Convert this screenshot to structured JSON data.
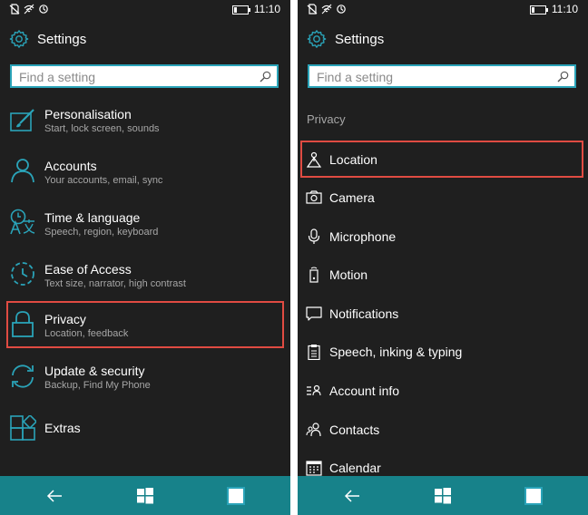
{
  "status": {
    "time": "11:10"
  },
  "left": {
    "header_title": "Settings",
    "search_placeholder": "Find a setting",
    "items": [
      {
        "label": "Personalisation",
        "sub": "Start, lock screen, sounds",
        "icon": "personalisation-icon"
      },
      {
        "label": "Accounts",
        "sub": "Your accounts, email, sync",
        "icon": "person-icon"
      },
      {
        "label": "Time & language",
        "sub": "Speech, region, keyboard",
        "icon": "time-language-icon"
      },
      {
        "label": "Ease of Access",
        "sub": "Text size, narrator, high contrast",
        "icon": "ease-of-access-icon"
      },
      {
        "label": "Privacy",
        "sub": "Location, feedback",
        "icon": "lock-icon"
      },
      {
        "label": "Update & security",
        "sub": "Backup, Find My Phone",
        "icon": "sync-icon"
      },
      {
        "label": "Extras",
        "sub": "",
        "icon": "extras-icon"
      }
    ],
    "highlighted_item": "Privacy"
  },
  "right": {
    "header_title": "Settings",
    "search_placeholder": "Find a setting",
    "section_title": "Privacy",
    "items": [
      {
        "label": "Location",
        "icon": "location-icon"
      },
      {
        "label": "Camera",
        "icon": "camera-icon"
      },
      {
        "label": "Microphone",
        "icon": "microphone-icon"
      },
      {
        "label": "Motion",
        "icon": "motion-icon"
      },
      {
        "label": "Notifications",
        "icon": "notifications-icon"
      },
      {
        "label": "Speech, inking & typing",
        "icon": "clipboard-icon"
      },
      {
        "label": "Account info",
        "icon": "account-info-icon"
      },
      {
        "label": "Contacts",
        "icon": "contacts-icon"
      },
      {
        "label": "Calendar",
        "icon": "calendar-icon"
      }
    ],
    "highlighted_item": "Location"
  },
  "navbar": {
    "buttons": [
      "back",
      "start",
      "search"
    ]
  },
  "colors": {
    "background": "#1f1f1f",
    "accent": "#2aa3b8",
    "navbar": "#17828a",
    "highlight": "#e04b42",
    "subtext": "#a6a6a6"
  }
}
